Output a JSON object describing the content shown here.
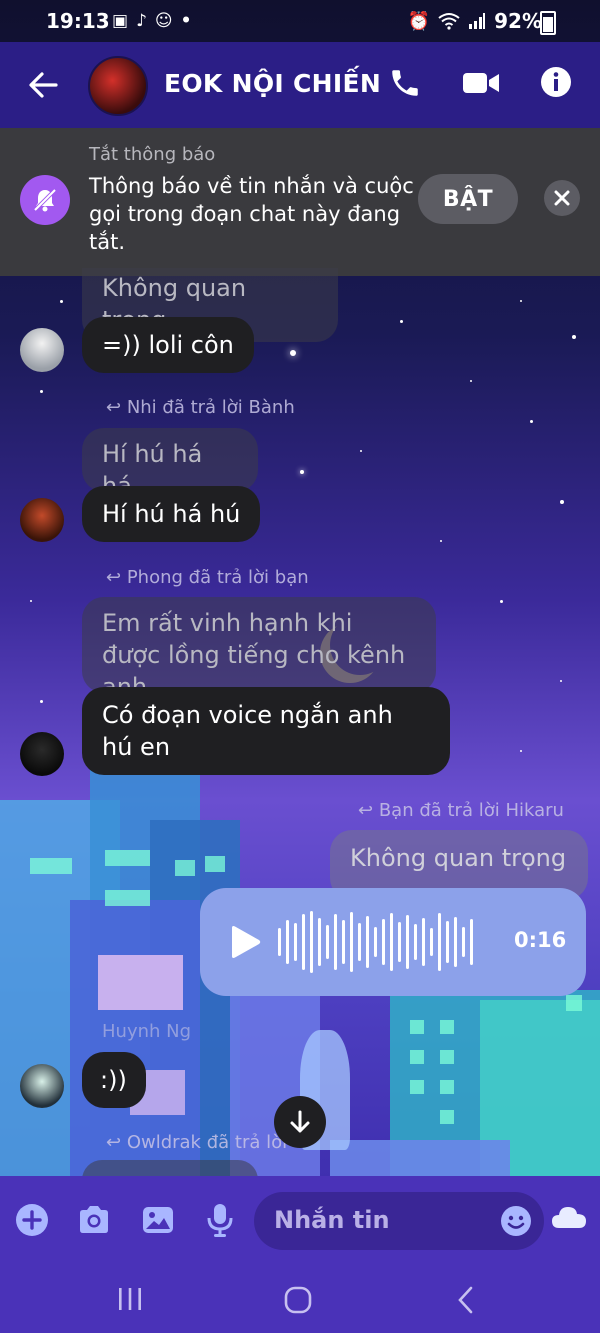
{
  "status_bar": {
    "time": "19:13",
    "battery": "92%"
  },
  "header": {
    "title": "EOK NỘI CHIẾN"
  },
  "banner": {
    "label": "Tắt thông báo",
    "text": "Thông báo về tin nhắn và cuộc gọi trong đoạn chat này đang tắt.",
    "button": "BẬT"
  },
  "messages": {
    "m1_faded": "Không quan trọng",
    "m1": "=)) loli côn",
    "reply1": "Nhi đã trả lời Bành",
    "m2_faded": "Hí hú há há",
    "m2": "Hí hú há hú",
    "reply2": "Phong đã trả lời bạn",
    "m3_faded": "Em rất vinh hạnh khi được lồng tiếng cho kênh anh",
    "m3": "Có đoạn voice ngắn anh hú en",
    "reply3": "Bạn đã trả lời Hikaru",
    "m4_faded": "Không quan trọng",
    "voice_duration": "0:16",
    "sender5": "Huynh Ng",
    "m5": ":))",
    "reply4": "Owldrak đã trả lời"
  },
  "composer": {
    "placeholder": "Nhắn tin"
  },
  "colors": {
    "header_bg": "#2b1e86",
    "banner_bg": "#3a3a3e",
    "bell_accent": "#a259f0",
    "voice_bg": "#8ca1ea",
    "composer_bg": "#4a32b8"
  }
}
